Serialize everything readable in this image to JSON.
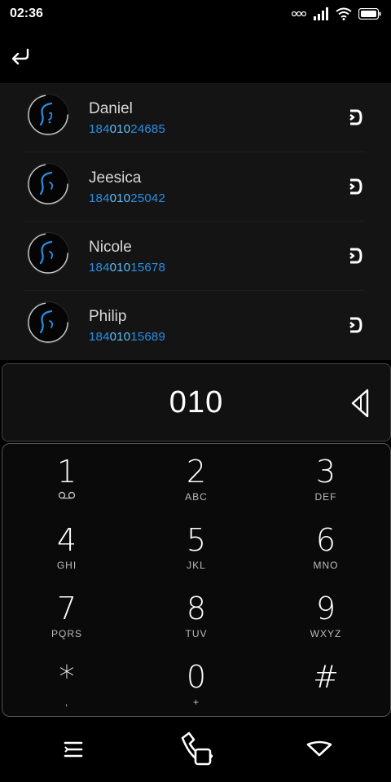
{
  "status": {
    "time": "02:36"
  },
  "contacts": [
    {
      "name": "Daniel",
      "number_pre": "184",
      "number_hl": "010",
      "number_post": "24685"
    },
    {
      "name": "Jeesica",
      "number_pre": "184",
      "number_hl": "010",
      "number_post": "25042"
    },
    {
      "name": "Nicole",
      "number_pre": "184",
      "number_hl": "010",
      "number_post": "15678"
    },
    {
      "name": "Philip",
      "number_pre": "184",
      "number_hl": "010",
      "number_post": "15689"
    }
  ],
  "dialer": {
    "input": "010"
  },
  "keys": [
    {
      "digit": "1",
      "letters": ""
    },
    {
      "digit": "2",
      "letters": "ABC"
    },
    {
      "digit": "3",
      "letters": "DEF"
    },
    {
      "digit": "4",
      "letters": "GHI"
    },
    {
      "digit": "5",
      "letters": "JKL"
    },
    {
      "digit": "6",
      "letters": "MNO"
    },
    {
      "digit": "7",
      "letters": "PQRS"
    },
    {
      "digit": "8",
      "letters": "TUV"
    },
    {
      "digit": "9",
      "letters": "WXYZ"
    },
    {
      "digit": "*",
      "letters": ","
    },
    {
      "digit": "0",
      "letters": "+"
    },
    {
      "digit": "#",
      "letters": ""
    }
  ],
  "colors": {
    "number_blue": "#2a8fe6",
    "number_highlight": "#5fc0ff",
    "panel_bg": "#141414"
  }
}
